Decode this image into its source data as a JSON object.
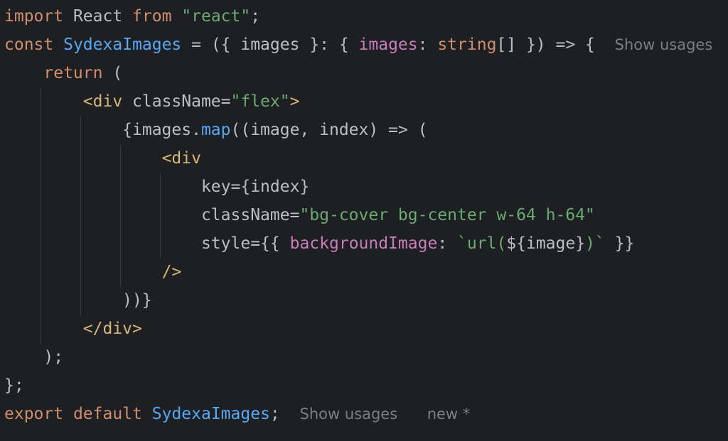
{
  "editor": {
    "line1": {
      "kw_import": "import",
      "react_name": " React ",
      "kw_from": "from",
      "sp": " ",
      "module": "\"react\"",
      "semi": ";"
    },
    "line2": {
      "kw_const": "const",
      "sp1": " ",
      "component": "SydexaImages",
      "arrow_start": " = ({ images }: { ",
      "prop_images": "images",
      "colon": ": ",
      "type_string": "string",
      "arr_close": "[] }) => {",
      "gap": "  ",
      "show_usages": "Show usages"
    },
    "line3": {
      "indent": "    ",
      "kw_return": "return",
      "rest": " ("
    },
    "line4": {
      "indent": "        ",
      "tag_open": "<div",
      "sp": " ",
      "attr_classname": "className",
      "eq": "=",
      "class_value": "\"flex\"",
      "tag_close": ">"
    },
    "line5": {
      "indent": "            ",
      "brace": "{images.",
      "method_map": "map",
      "rest": "((image, index) => ("
    },
    "line6": {
      "indent": "                ",
      "tag_open": "<div"
    },
    "line7": {
      "indent": "                    ",
      "attr_key": "key",
      "eq": "=",
      "value": "{index}"
    },
    "line8": {
      "indent": "                    ",
      "attr_classname": "className",
      "eq": "=",
      "class_value": "\"bg-cover bg-center w-64 h-64\""
    },
    "line9": {
      "indent": "                    ",
      "attr_style": "style",
      "eq": "=",
      "open": "{{ ",
      "prop_bg": "backgroundImage",
      "colon": ": ",
      "tmpl_start": "`url(",
      "interp": "${image}",
      "tmpl_end": ")`",
      "close": " }}"
    },
    "line10": {
      "indent": "                ",
      "self_close": "/>"
    },
    "line11": {
      "indent": "            ",
      "text": "))}"
    },
    "line12": {
      "indent": "        ",
      "tag_close": "</div>"
    },
    "line13": {
      "indent": "    ",
      "text": ");"
    },
    "line14": {
      "text": "};"
    },
    "line15": {
      "kw_export": "export",
      "sp1": " ",
      "kw_default": "default",
      "sp2": " ",
      "component": "SydexaImages",
      "semi": ";",
      "gap": "  ",
      "show_usages": "Show usages",
      "gap2": "   ",
      "new_marker": "new *"
    }
  },
  "colors": {
    "background": "#1e1f22",
    "text": "#bcbec4",
    "keyword": "#cf8e6d",
    "function": "#56a8f5",
    "property": "#c77dbb",
    "string": "#6aab73",
    "tag": "#d5b778",
    "hint": "#7a7e85",
    "indent_guide": "#393b40"
  }
}
